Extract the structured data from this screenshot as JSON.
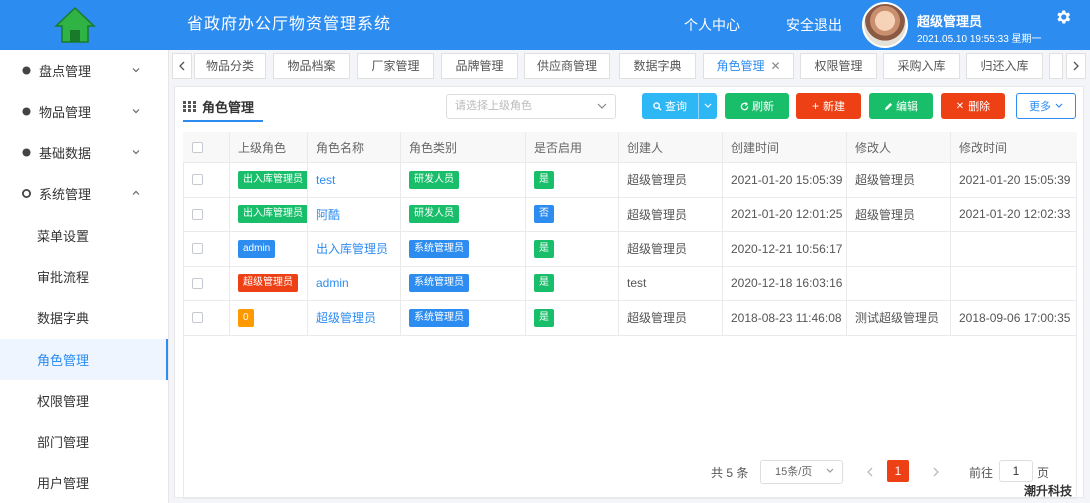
{
  "header": {
    "title": "省政府办公厅物资管理系统",
    "nav": [
      "个人中心",
      "安全退出"
    ],
    "user_name": "超级管理员",
    "user_time": "2021.05.10 19:55:33 星期一"
  },
  "sidebar": {
    "groups": [
      "盘点管理",
      "物品管理",
      "基础数据",
      "系统管理"
    ],
    "subitems": [
      "菜单设置",
      "审批流程",
      "数据字典",
      "角色管理",
      "权限管理",
      "部门管理",
      "用户管理"
    ],
    "active": "角色管理"
  },
  "tabs": [
    "物品分类",
    "物品档案",
    "厂家管理",
    "品牌管理",
    "供应商管理",
    "数据字典",
    "角色管理",
    "权限管理",
    "采购入库",
    "归还入库"
  ],
  "active_tab": "角色管理",
  "panel": {
    "title": "角色管理",
    "select_placeholder": "请选择上级角色",
    "buttons": {
      "query": "查询",
      "refresh": "刷新",
      "add": "新建",
      "edit": "编辑",
      "delete": "删除",
      "more": "更多"
    }
  },
  "table": {
    "columns": [
      "上级角色",
      "角色名称",
      "角色类别",
      "是否启用",
      "创建人",
      "创建时间",
      "修改人",
      "修改时间"
    ],
    "rows": [
      {
        "parent": "出入库管理员",
        "parent_color": "#19be6b",
        "name": "test",
        "name_link": true,
        "type": "研发人员",
        "type_color": "#19be6b",
        "enabled": "是",
        "enabled_color": "#19be6b",
        "creator": "超级管理员",
        "created": "2021-01-20 15:05:39",
        "modifier": "超级管理员",
        "modified": "2021-01-20 15:05:39"
      },
      {
        "parent": "出入库管理员",
        "parent_color": "#19be6b",
        "name": "阿酷",
        "name_link": true,
        "type": "研发人员",
        "type_color": "#19be6b",
        "enabled": "否",
        "enabled_color": "#2d8cf0",
        "creator": "超级管理员",
        "created": "2021-01-20 12:01:25",
        "modifier": "超级管理员",
        "modified": "2021-01-20 12:02:33"
      },
      {
        "parent": "admin",
        "parent_color": "#2d8cf0",
        "name": "出入库管理员",
        "name_link": true,
        "type": "系统管理员",
        "type_color": "#2d8cf0",
        "enabled": "是",
        "enabled_color": "#19be6b",
        "creator": "超级管理员",
        "created": "2020-12-21 10:56:17",
        "modifier": "",
        "modified": ""
      },
      {
        "parent": "超级管理员",
        "parent_color": "#ed4014",
        "name": "admin",
        "name_link": true,
        "type": "系统管理员",
        "type_color": "#2d8cf0",
        "enabled": "是",
        "enabled_color": "#19be6b",
        "creator": "test",
        "created": "2020-12-18 16:03:16",
        "modifier": "",
        "modified": ""
      },
      {
        "parent": "0",
        "parent_color": "#ff9900",
        "name": "超级管理员",
        "name_link": true,
        "type": "系统管理员",
        "type_color": "#2d8cf0",
        "enabled": "是",
        "enabled_color": "#19be6b",
        "creator": "超级管理员",
        "created": "2018-08-23 11:46:08",
        "modifier": "测试超级管理员",
        "modified": "2018-09-06 17:00:35"
      }
    ]
  },
  "pager": {
    "total": "共 5 条",
    "page_size": "15条/页",
    "current": "1",
    "goto_label": "前往",
    "goto_value": "1",
    "page_unit": "页"
  },
  "watermark": "潮升科技",
  "colors": {
    "primary": "#2d8cf0",
    "success": "#19be6b",
    "danger": "#ed4014",
    "info": "#2db7f5",
    "warning": "#ff9900"
  }
}
